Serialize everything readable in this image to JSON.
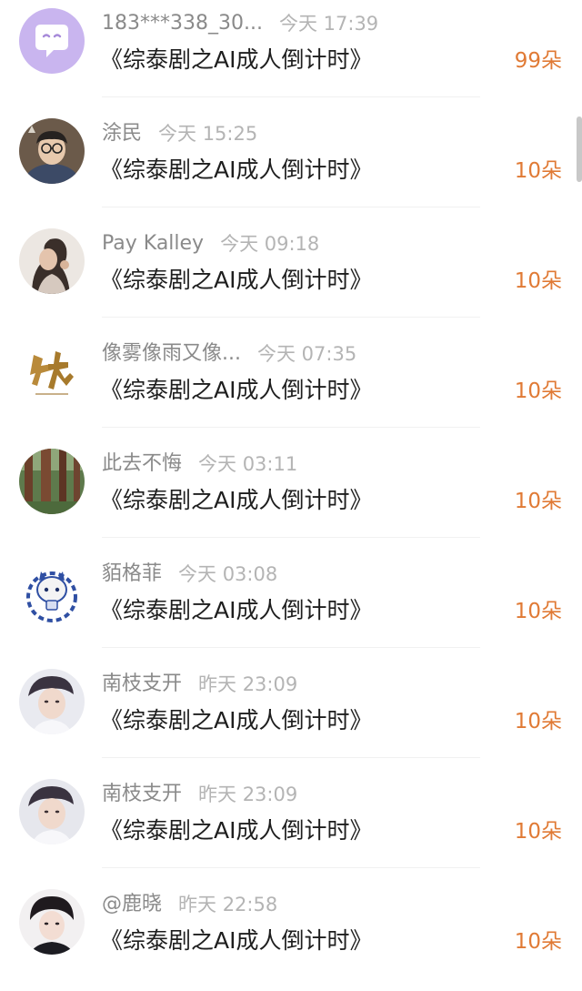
{
  "entries": [
    {
      "user": "183***338_30...",
      "time": "今天 17:39",
      "title": "《综泰剧之AI成人倒计时》",
      "count": "99朵",
      "avatar_icon": "purple-chat-bubble-avatar"
    },
    {
      "user": "涂民",
      "time": "今天 15:25",
      "title": "《综泰剧之AI成人倒计时》",
      "count": "10朵",
      "avatar_icon": "man-with-glasses-avatar"
    },
    {
      "user": "Pay Kalley",
      "time": "今天 09:18",
      "title": "《综泰剧之AI成人倒计时》",
      "count": "10朵",
      "avatar_icon": "girl-portrait-avatar"
    },
    {
      "user": "像雾像雨又像...",
      "time": "今天 07:35",
      "title": "《综泰剧之AI成人倒计时》",
      "count": "10朵",
      "avatar_icon": "calligraphy-logo-avatar"
    },
    {
      "user": "此去不悔",
      "time": "今天 03:11",
      "title": "《综泰剧之AI成人倒计时》",
      "count": "10朵",
      "avatar_icon": "forest-avatar"
    },
    {
      "user": "貊格菲",
      "time": "今天 03:08",
      "title": "《综泰剧之AI成人倒计时》",
      "count": "10朵",
      "avatar_icon": "porcelain-cat-avatar"
    },
    {
      "user": "南枝支开",
      "time": "昨天 23:09",
      "title": "《综泰剧之AI成人倒计时》",
      "count": "10朵",
      "avatar_icon": "man-portrait-avatar"
    },
    {
      "user": "南枝支开",
      "time": "昨天 23:09",
      "title": "《综泰剧之AI成人倒计时》",
      "count": "10朵",
      "avatar_icon": "man-portrait-avatar"
    },
    {
      "user": "@鹿晓",
      "time": "昨天 22:58",
      "title": "《综泰剧之AI成人倒计时》",
      "count": "10朵",
      "avatar_icon": "man-portrait-avatar"
    }
  ],
  "colors": {
    "username": "#8a8a8a",
    "time": "#b4b4b4",
    "title": "#1e1e1e",
    "gift_count": "#e07a35"
  }
}
